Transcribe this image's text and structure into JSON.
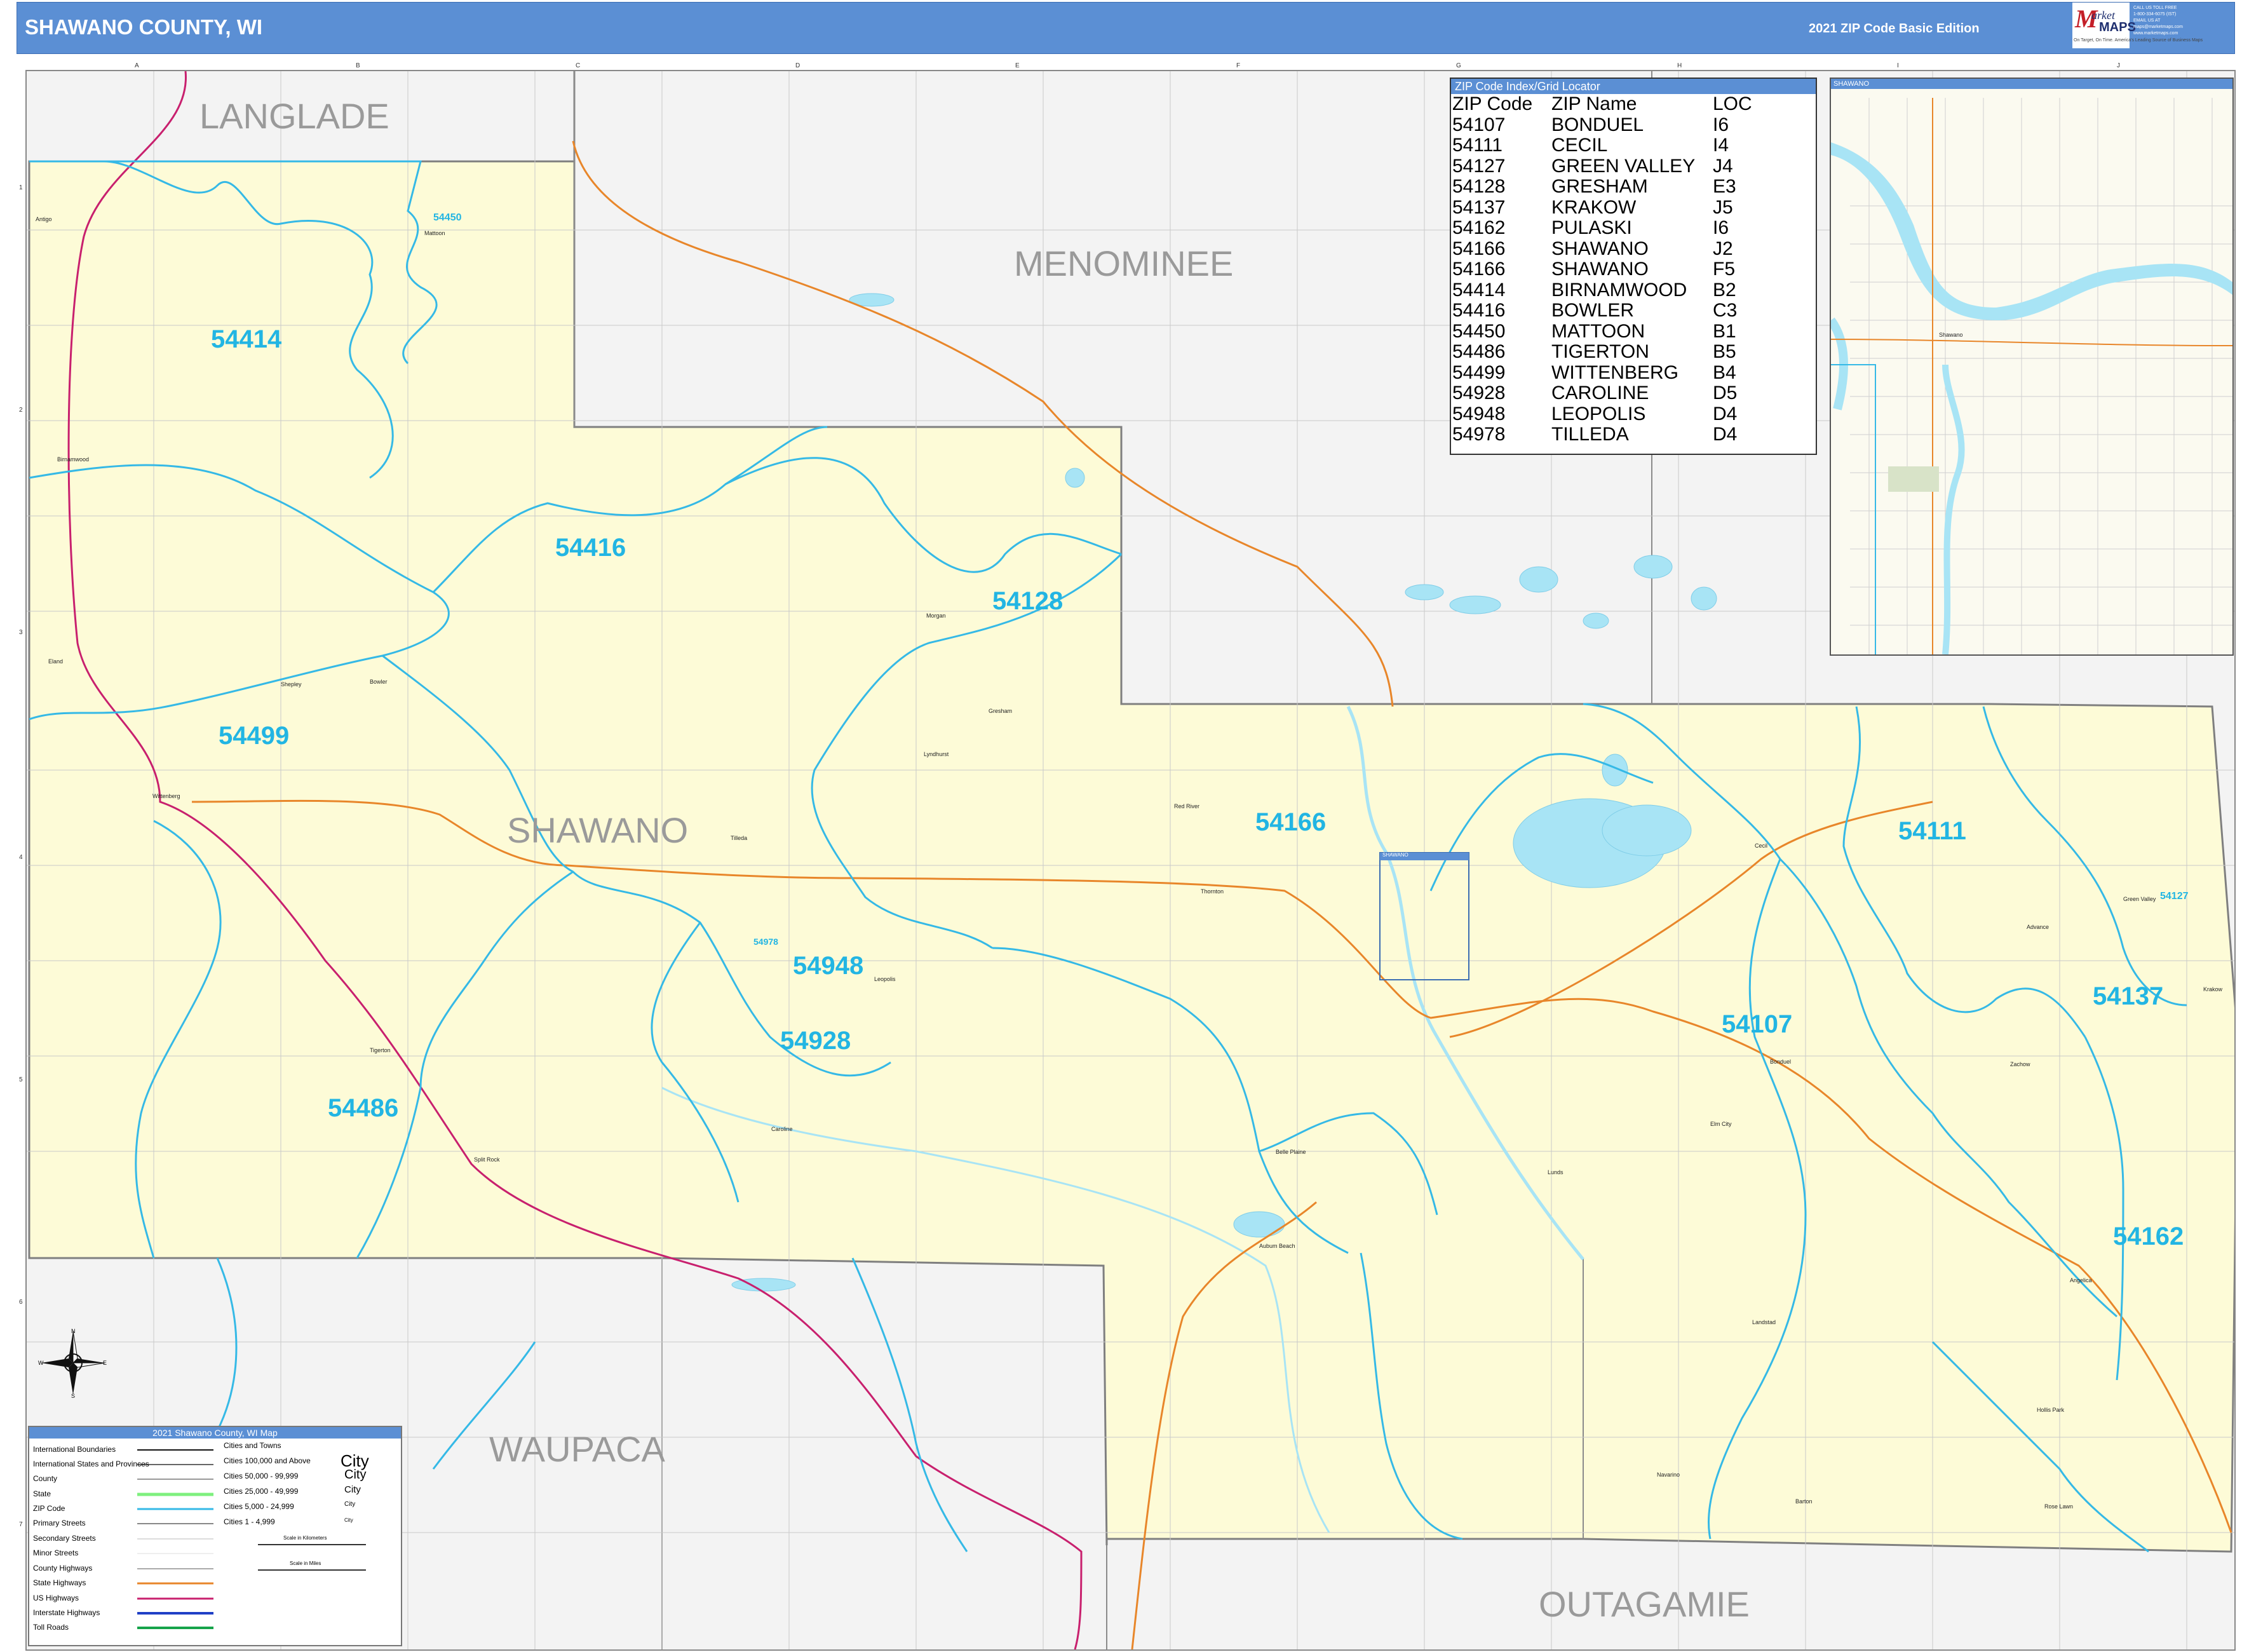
{
  "header": {
    "title": "SHAWANO COUNTY, WI",
    "edition": "2021 ZIP Code Basic Edition",
    "logo": {
      "m": "M",
      "line1": "arket",
      "line2": "MAPS",
      "tagline": "On Target, On Time. America's Leading Source of Business Maps"
    },
    "contact": [
      "CALL US TOLL FREE",
      "1-800-334-6075 (IST)",
      "EMAIL US AT",
      "maps@marketmaps.com",
      "www.marketmaps.com"
    ]
  },
  "grid": {
    "columns": [
      "A",
      "B",
      "C",
      "D",
      "E",
      "F",
      "G",
      "H",
      "I",
      "J"
    ],
    "rows": [
      "1",
      "2",
      "3",
      "4",
      "5",
      "6",
      "7"
    ]
  },
  "counties": {
    "langlade": "LANGLADE",
    "menominee": "MENOMINEE",
    "shawano": "SHAWANO",
    "waupaca": "WAUPACA",
    "outagamie": "OUTAGAMIE"
  },
  "zip_labels": {
    "z54414": "54414",
    "z54416": "54416",
    "z54128": "54128",
    "z54499": "54499",
    "z54166": "54166",
    "z54111": "54111",
    "z54948": "54948",
    "z54928": "54928",
    "z54486": "54486",
    "z54107": "54107",
    "z54137": "54137",
    "z54162": "54162",
    "small_54450": "54450",
    "small_54978": "54978",
    "small_54127": "54127"
  },
  "zip_index": {
    "header": "ZIP Code Index/Grid Locator",
    "columns": [
      "ZIP Code",
      "ZIP Name",
      "LOC"
    ],
    "rows": [
      [
        "54107",
        "BONDUEL",
        "I6"
      ],
      [
        "54111",
        "CECIL",
        "I4"
      ],
      [
        "54127",
        "GREEN VALLEY",
        "J4"
      ],
      [
        "54128",
        "GRESHAM",
        "E3"
      ],
      [
        "54137",
        "KRAKOW",
        "J5"
      ],
      [
        "54162",
        "PULASKI",
        "I6"
      ],
      [
        "54166",
        "SHAWANO",
        "J2"
      ],
      [
        "54166",
        "SHAWANO",
        "F5"
      ],
      [
        "54414",
        "BIRNAMWOOD",
        "B2"
      ],
      [
        "54416",
        "BOWLER",
        "C3"
      ],
      [
        "54450",
        "MATTOON",
        "B1"
      ],
      [
        "54486",
        "TIGERTON",
        "B5"
      ],
      [
        "54499",
        "WITTENBERG",
        "B4"
      ],
      [
        "54928",
        "CAROLINE",
        "D5"
      ],
      [
        "54948",
        "LEOPOLIS",
        "D4"
      ],
      [
        "54978",
        "TILLEDA",
        "D4"
      ]
    ]
  },
  "inset": {
    "title": "SHAWANO",
    "town": "Shawano"
  },
  "small_inset_label": "SHAWANO",
  "towns": {
    "antigo": "Antigo",
    "mattoon": "Mattoon",
    "birnamwood": "Birnamwood",
    "eland": "Eland",
    "shepley": "Shepley",
    "bowler": "Bowler",
    "wittenberg": "Wittenberg",
    "tilleda": "Tilleda",
    "leopolis": "Leopolis",
    "tigerton": "Tigerton",
    "splitrock": "Split Rock",
    "caroline": "Caroline",
    "morgan": "Morgan",
    "gresham": "Gresham",
    "lyndhurst": "Lyndhurst",
    "redriver": "Red River",
    "thornton": "Thornton",
    "cecil": "Cecil",
    "greenvalley": "Green Valley",
    "advance": "Advance",
    "krakow": "Krakow",
    "bonduel": "Bonduel",
    "zachow": "Zachow",
    "bellepl": "Belle Plaine",
    "lunds": "Lunds",
    "elmcity": "Elm City",
    "aubbeach": "Aubum Beach",
    "angelica": "Angelica",
    "landstad": "Landstad",
    "navarino": "Navarino",
    "hollypk": "Hollis Park",
    "bbarton": "Barton",
    "roselawn": "Rose Lawn"
  },
  "compass": {
    "n": "N",
    "s": "S",
    "e": "E",
    "w": "W"
  },
  "legend": {
    "header": "2021 Shawano County, WI Map",
    "items": [
      "International Boundaries",
      "International States and Provinces",
      "County",
      "State",
      "ZIP Code",
      "Primary Streets",
      "Secondary Streets",
      "Minor Streets",
      "County Highways",
      "State Highways",
      "US Highways",
      "Interstate Highways",
      "Toll Roads"
    ],
    "cities_header": "Cities and Towns",
    "cities": [
      {
        "label": "Cities 100,000 and Above",
        "sample": "City"
      },
      {
        "label": "Cities 50,000 - 99,999",
        "sample": "City"
      },
      {
        "label": "Cities 25,000 - 49,999",
        "sample": "City"
      },
      {
        "label": "Cities 5,000 - 24,999",
        "sample": "City"
      },
      {
        "label": "Cities 1 - 4,999",
        "sample": "City"
      }
    ],
    "scale_km": "Scale in Kilometers",
    "scale_mi": "Scale in Miles"
  },
  "colors": {
    "header_bg": "#5b8fd4",
    "county_fill": "#fdfbd7",
    "outside_fill": "#f3f3f3",
    "zip_line": "#35b9e6",
    "zip_label": "#22b5e3",
    "water": "#a8e4f5",
    "highway_orange": "#e8862a",
    "us_highway": "#c8206e",
    "county_label": "#9a9a9a"
  }
}
